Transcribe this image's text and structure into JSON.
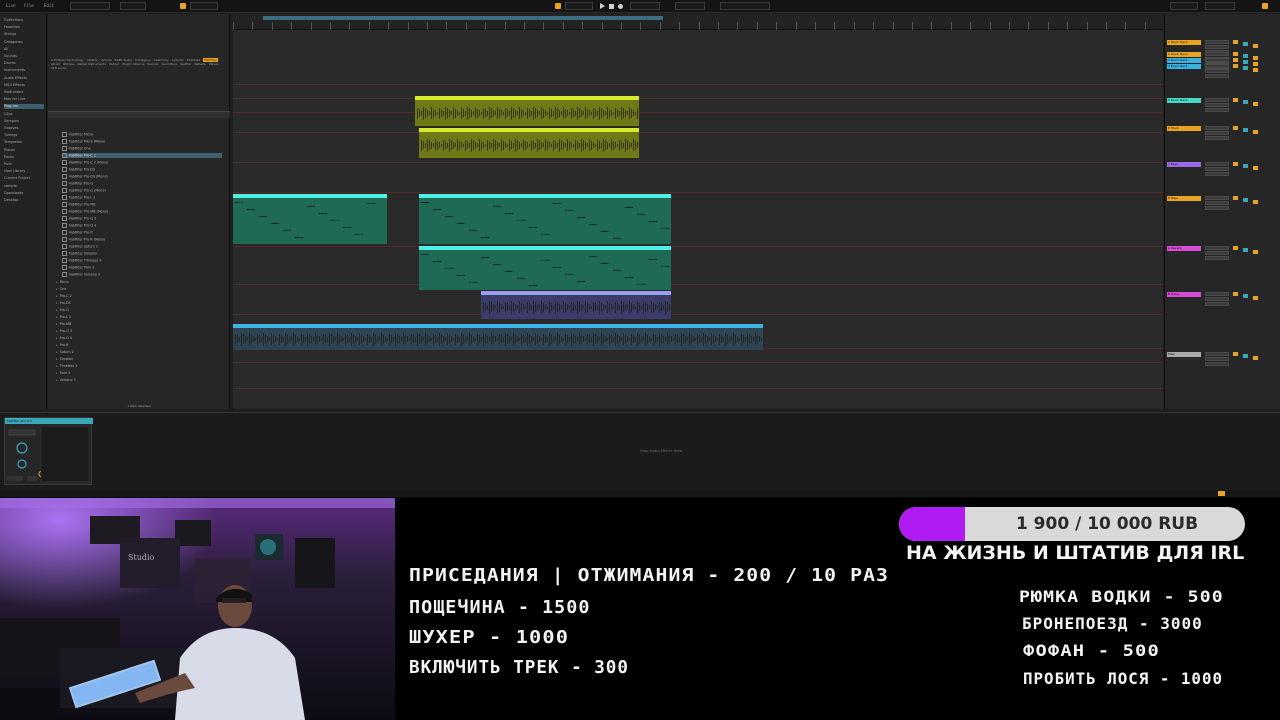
{
  "daw": {
    "places": [
      "Collections",
      "Favorites",
      "Strings",
      "Categories",
      "All",
      "Sounds",
      "Drums",
      "Instruments",
      "Audio Effects",
      "MIDI Effects",
      "Modulators",
      "Max for Live",
      "Plug-Ins",
      "Clips",
      "Samples",
      "Grooves",
      "Tunings",
      "Templates",
      "Places",
      "Packs",
      "Push",
      "User Library",
      "Current Project",
      "sample",
      "Downloads",
      "Desktop"
    ],
    "browser": {
      "vendors": [
        "A.M Music Technology",
        "Ableton",
        "Arturia",
        "BABY Audio",
        "Cableguys",
        "Celemony",
        "Cytomic",
        "Eventide",
        "FabFilter",
        "Ghost",
        "iZotope",
        "Native Instruments",
        "Output",
        "Plugin Alliance",
        "Sonnox",
        "Soundtoys",
        "Spitfire",
        "Valhalla",
        "Waves",
        "XLN Audio"
      ],
      "files": [
        "FabFilter Micro",
        "FabFilter Micro (Mono)",
        "FabFilter One",
        "FabFilter Pro-C 2",
        "FabFilter Pro-C 2 (Mono)",
        "FabFilter Pro-DS",
        "FabFilter Pro-DS (Mono)",
        "FabFilter Pro-G",
        "FabFilter Pro-G (Mono)",
        "FabFilter Pro-L 2",
        "FabFilter Pro-MB",
        "FabFilter Pro-MB (Mono)",
        "FabFilter Pro-Q 3",
        "FabFilter Pro-Q 4",
        "FabFilter Pro-R",
        "FabFilter Pro-R (Mono)",
        "FabFilter Saturn 2",
        "FabFilter Simplon",
        "FabFilter Timeless 3",
        "FabFilter Twin 3",
        "FabFilter Volcano 3"
      ],
      "folders": [
        "Micro",
        "One",
        "Pro-C 2",
        "Pro-DS",
        "Pro-G",
        "Pro-L 2",
        "Pro-MB",
        "Pro-Q 3",
        "Pro-Q 4",
        "Pro-R",
        "Saturn 2",
        "Simplon",
        "Timeless 3",
        "Twin 3",
        "Volcano 3"
      ],
      "status": "1 Item selected"
    },
    "device_title": "FabFilter Pro-Q 3",
    "drop_hint": "Drop Audio Effects Here",
    "mixer_tracks": [
      "1 Drum Rack",
      "2 Drum Rack",
      "3 Drum Rack",
      "4 Drum Rack",
      "5 Drum Rack",
      "6 Pluck",
      "7 Keys",
      "8 Bass",
      "A Reverb",
      "B Delay",
      "Main"
    ],
    "colors": {
      "accent": "#e8a422",
      "clip_yellow": "#d4ea2a",
      "clip_cyan": "#4cf0e4",
      "clip_lavender": "#9b9ef2",
      "clip_blue": "#3db3e8"
    }
  },
  "overlay": {
    "donation_goal": {
      "label": "1 900 / 10 000 RUB",
      "current": 1900,
      "target": 10000,
      "caption": "НА ЖИЗНЬ И ШТАТИВ ДЛЯ IRL"
    },
    "left_list": [
      "ПРИСЕДАНИЯ | ОТЖИМАНИЯ - 200 / 10 РАЗ",
      "ПОЩЕЧИНА - 1500",
      "ШУХЕР - 1000",
      "ВКЛЮЧИТЬ ТРЕК - 300"
    ],
    "right_list": [
      "РЮМКА ВОДКИ - 500",
      "БРОНЕПОЕЗД - 3000",
      "ФОФАН - 500",
      "ПРОБИТЬ ЛОСЯ - 1000"
    ],
    "fill_color": "#b01bf3"
  }
}
